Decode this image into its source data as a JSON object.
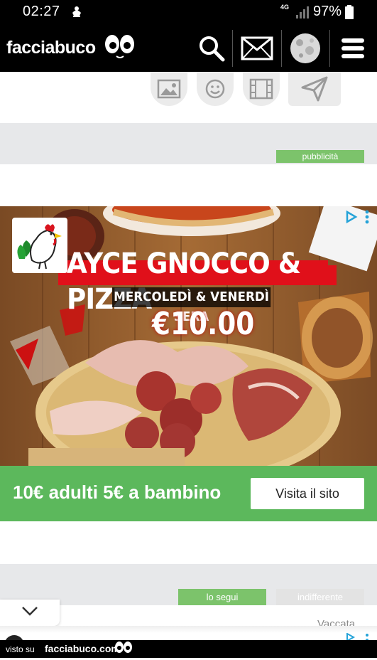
{
  "status_bar": {
    "time": "02:27",
    "network": "4G",
    "battery": "97%",
    "icons": [
      "notification-icon",
      "signal-icon",
      "battery-icon"
    ]
  },
  "header": {
    "brand": "facciabuco",
    "icons": [
      "search-icon",
      "mail-icon",
      "moon-avatar-icon",
      "menu-icon"
    ]
  },
  "composer": {
    "buttons": [
      "image-icon",
      "emoji-icon",
      "video-icon",
      "send-icon"
    ]
  },
  "ad": {
    "tag": "pubblicità",
    "title": "AYCE GNOCCO & PIZZA",
    "subtitle": "MERCOLEDÌ & VENERDÌ SERA",
    "price": "€10.00",
    "bar_text": "10€ adulti 5€ a bambino",
    "cta": "Visita il sito",
    "colors": {
      "bar": "#5cb85c",
      "red_banner": "#e0101a"
    }
  },
  "post": {
    "tags": [
      "lo segui",
      "indifferente"
    ],
    "vote_label": "Vaccata"
  },
  "footer": {
    "visto": "visto su",
    "site": "facciabuco.com"
  }
}
